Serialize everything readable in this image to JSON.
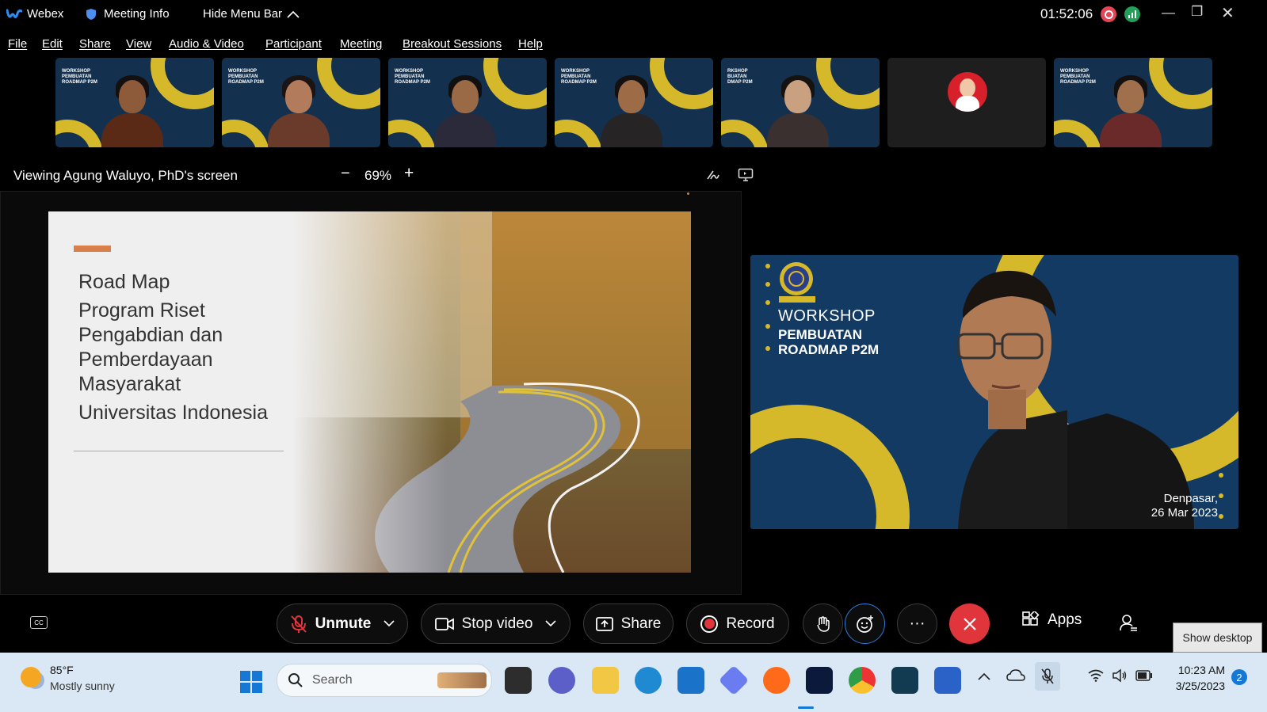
{
  "titlebar": {
    "app_name": "Webex",
    "meeting_info": "Meeting Info",
    "hide_menu": "Hide Menu Bar",
    "timer": "01:52:06"
  },
  "menu": [
    "File",
    "Edit",
    "Share",
    "View",
    "Audio & Video",
    "Participant",
    "Meeting",
    "Breakout Sessions",
    "Help"
  ],
  "thumbnails": [
    {
      "caption": "WORKSHOP\nPEMBUATAN\nROADMAP P2M",
      "skin": "#8d5b3a",
      "hair": "#151010",
      "shirt": "#5a2a16"
    },
    {
      "caption": "WORKSHOP\nPEMBUATAN\nROADMAP P2M",
      "skin": "#b27b5c",
      "hair": "#1b1412",
      "shirt": "#6a3a2a"
    },
    {
      "caption": "WORKSHOP\nPEMBUATAN\nROADMAP P2M",
      "skin": "#9a6a46",
      "hair": "#101010",
      "shirt": "#2a2a3a"
    },
    {
      "caption": "WORKSHOP\nPEMBUATAN\nROADMAP P2M",
      "skin": "#9d6b45",
      "hair": "#121010",
      "shirt": "#262424"
    },
    {
      "caption": "RKSHOP\nBUATAN\nDMAP P2M",
      "skin": "#c9a080",
      "hair": "#161210",
      "shirt": "#3a3030"
    },
    {
      "caption": "",
      "skin": "",
      "hair": "",
      "shirt": ""
    },
    {
      "caption": "WORKSHOP\nPEMBUATAN\nROADMAP P2M",
      "skin": "#a0704c",
      "hair": "#141010",
      "shirt": "#6a2a2a"
    }
  ],
  "view": {
    "viewing": "Viewing Agung Waluyo, PhD's screen",
    "zoom": "69%"
  },
  "slide": {
    "line1": "Road Map",
    "line2": "Program Riset",
    "line3": "Pengabdian dan",
    "line4": "Pemberdayaan",
    "line5": "Masyarakat",
    "line6": "Universitas Indonesia"
  },
  "speaker": {
    "workshop": "WORKSHOP",
    "title1": "PEMBUATAN",
    "title2": "ROADMAP P2M",
    "place": "Denpasar,",
    "date": "26 Mar 2023"
  },
  "controls": {
    "unmute": "Unmute",
    "stop_video": "Stop video",
    "share": "Share",
    "record": "Record",
    "more": "···",
    "apps": "Apps",
    "show_desktop": "Show desktop"
  },
  "colors": {
    "accent_yellow": "#d6b92a",
    "end_call": "#e0353a",
    "record_red": "#e0353a"
  },
  "taskbar": {
    "temp": "85°F",
    "weather": "Mostly sunny",
    "search": "Search",
    "time": "10:23 AM",
    "date": "3/25/2023",
    "notifications": "2"
  }
}
